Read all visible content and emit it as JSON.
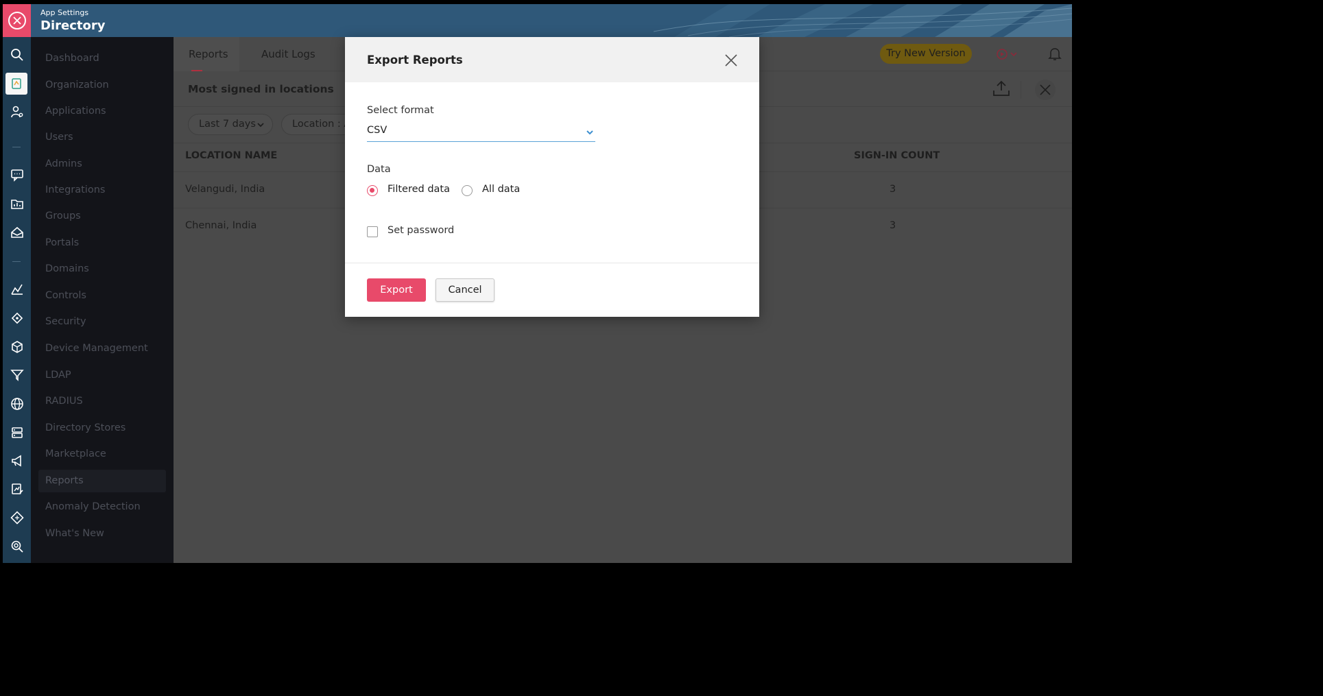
{
  "app": {
    "subtitle": "App Settings",
    "title": "Directory"
  },
  "nav": {
    "items": [
      {
        "label": "Dashboard"
      },
      {
        "label": "Organization"
      },
      {
        "label": "Applications"
      },
      {
        "label": "Users"
      },
      {
        "label": "Admins"
      },
      {
        "label": "Integrations"
      },
      {
        "label": "Groups"
      },
      {
        "label": "Portals"
      },
      {
        "label": "Domains"
      },
      {
        "label": "Controls"
      },
      {
        "label": "Security"
      },
      {
        "label": "Device Management"
      },
      {
        "label": "LDAP"
      },
      {
        "label": "RADIUS"
      },
      {
        "label": "Directory Stores"
      },
      {
        "label": "Marketplace"
      },
      {
        "label": "Reports"
      },
      {
        "label": "Anomaly Detection"
      },
      {
        "label": "What's New"
      }
    ],
    "active": "Reports"
  },
  "tabs": [
    {
      "label": "Reports"
    },
    {
      "label": "Audit Logs"
    }
  ],
  "topbar": {
    "try_new_version": "Try New Version"
  },
  "report": {
    "title": "Most signed in locations",
    "filters": {
      "period": "Last 7 days",
      "location": "Location : All"
    },
    "columns": {
      "location": "LOCATION NAME",
      "count": "SIGN-IN COUNT"
    },
    "rows": [
      {
        "location": "Velangudi, India",
        "count": "3"
      },
      {
        "location": "Chennai, India",
        "count": "3"
      }
    ]
  },
  "modal": {
    "title": "Export Reports",
    "format_label": "Select format",
    "format_value": "CSV",
    "data_label": "Data",
    "option_filtered": "Filtered data",
    "option_all": "All data",
    "selected_option": "Filtered data",
    "set_password": "Set password",
    "export": "Export",
    "cancel": "Cancel"
  },
  "colors": {
    "accent": "#e84a6a",
    "header": "#2f5879",
    "rail": "#1e3c52",
    "select_underline": "#5aa2d6"
  }
}
